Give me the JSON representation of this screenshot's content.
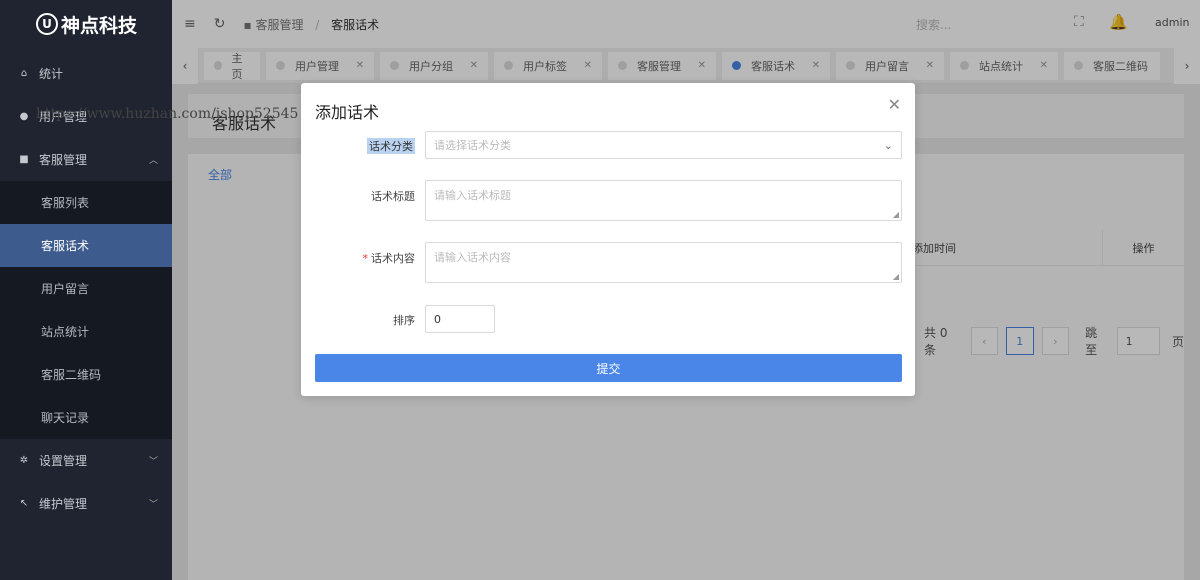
{
  "sidebar": {
    "logo_mark": "U",
    "logo": "神点科技",
    "items": [
      {
        "label": "统计",
        "icon": "home-icon"
      },
      {
        "label": "用户管理",
        "icon": "user-icon"
      },
      {
        "label": "客服管理",
        "icon": "chat-icon",
        "expanded": true
      }
    ],
    "submenu": [
      {
        "label": "客服列表"
      },
      {
        "label": "客服话术",
        "active": true
      },
      {
        "label": "用户留言"
      },
      {
        "label": "站点统计"
      },
      {
        "label": "客服二维码"
      },
      {
        "label": "聊天记录"
      }
    ],
    "bottom_items": [
      {
        "label": "设置管理",
        "icon": "gear-icon"
      },
      {
        "label": "维护管理",
        "icon": "wrench-icon"
      }
    ]
  },
  "topbar": {
    "breadcrumb_parent": "客服管理",
    "breadcrumb_sep": "/",
    "breadcrumb_current": "客服话术",
    "search_placeholder": "搜索...",
    "user": "admin"
  },
  "tabs": {
    "items": [
      "主页",
      "用户管理",
      "用户分组",
      "用户标签",
      "客服管理",
      "客服话术",
      "用户留言",
      "站点统计",
      "客服二维码"
    ],
    "active": "客服话术"
  },
  "page": {
    "title": "客服话术",
    "filter_all": "全部",
    "table_headers": [
      "添加时间",
      "操作"
    ],
    "pager": {
      "total": "共 0 条",
      "current": "1",
      "goto_label": "跳至",
      "goto_value": "1",
      "page_suffix": "页"
    }
  },
  "watermark": "https://www.huzhan.com/ishop52545",
  "modal": {
    "title": "添加话术",
    "fields": {
      "category": {
        "label": "话术分类",
        "placeholder": "请选择话术分类"
      },
      "title": {
        "label": "话术标题",
        "placeholder": "请输入话术标题"
      },
      "content": {
        "label": "话术内容",
        "placeholder": "请输入话术内容",
        "required_mark": "*"
      },
      "sort": {
        "label": "排序",
        "value": "0"
      }
    },
    "submit": "提交"
  },
  "colors": {
    "accent": "#4a86e8",
    "sidebar_bg": "#1f2430",
    "active_menu": "#3d5b8c"
  }
}
